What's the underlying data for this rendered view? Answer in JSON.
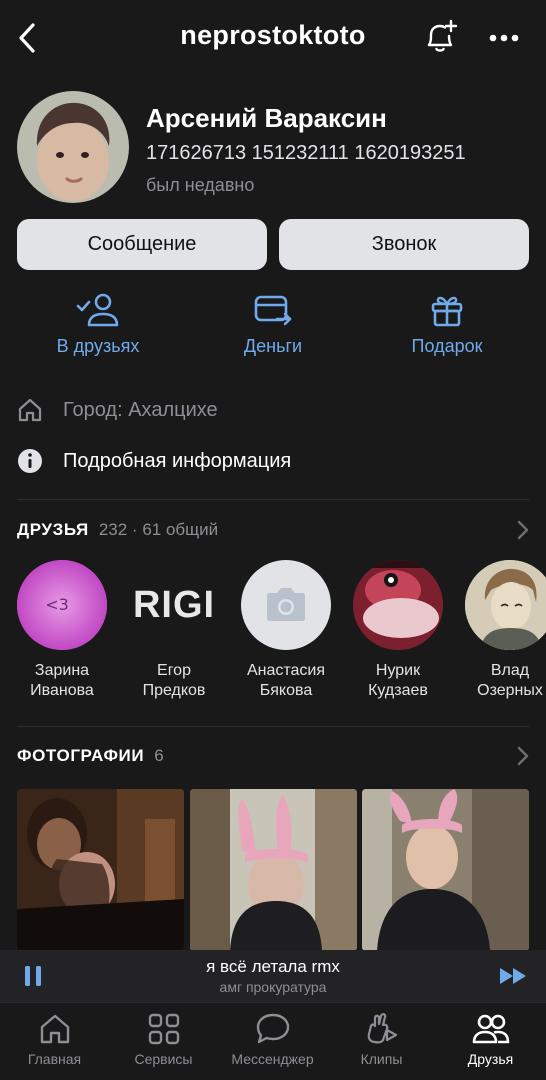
{
  "header": {
    "title": "neprostoktoto"
  },
  "profile": {
    "name": "Арсений Вараксин",
    "status": "171626713 151232111 1620193251",
    "last_seen": "был недавно"
  },
  "buttons": {
    "message": "Сообщение",
    "call": "Звонок"
  },
  "actions": {
    "friends": "В друзьях",
    "money": "Деньги",
    "gift": "Подарок"
  },
  "info": {
    "city": "Город: Ахалцихе",
    "details": "Подробная информация"
  },
  "friends_section": {
    "title": "ДРУЗЬЯ",
    "count": "232 · 61 общий",
    "items": [
      {
        "first": "Зарина",
        "last": "Иванова"
      },
      {
        "first": "Егор",
        "last": "Предков"
      },
      {
        "first": "Анастасия",
        "last": "Бякова"
      },
      {
        "first": "Нурик",
        "last": "Кудзаев"
      },
      {
        "first": "Влад",
        "last": "Озерных"
      }
    ],
    "avatar_texts": {
      "zarina": "<3",
      "egor": "RIGI"
    }
  },
  "photos_section": {
    "title": "ФОТОГРАФИИ",
    "count": "6"
  },
  "player": {
    "song": "я всё летала rmx",
    "artist": "амг прокуратура"
  },
  "tabbar": {
    "home": "Главная",
    "services": "Сервисы",
    "messenger": "Мессенджер",
    "clips": "Клипы",
    "friends": "Друзья"
  },
  "colors": {
    "background": "#19191a",
    "accent": "#71aaeb",
    "button_bg": "#e1e3e6",
    "secondary_text": "#8d8f94"
  }
}
